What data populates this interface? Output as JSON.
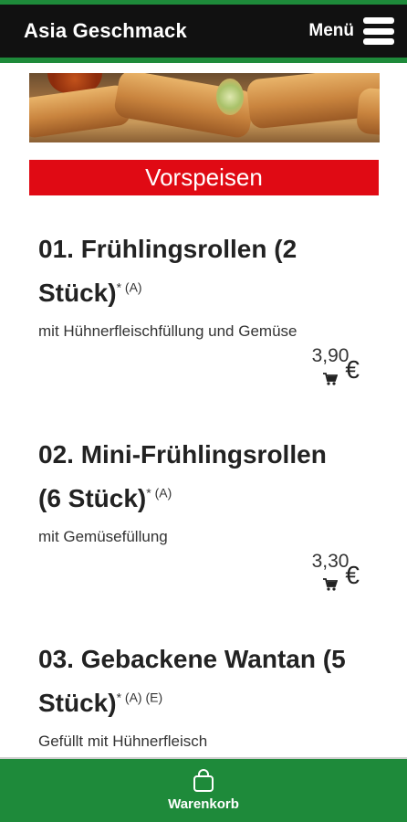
{
  "header": {
    "title": "Asia Geschmack",
    "menu_label": "Menü"
  },
  "section": {
    "title": "Vorspeisen"
  },
  "items": [
    {
      "title_line1": "01. Frühlingsrollen (2",
      "title_line2": "Stück)",
      "asterisk": "*",
      "allergens": "(A)",
      "description": "mit Hühnerfleischfüllung und Gemüse",
      "price": "3,90",
      "currency": "€"
    },
    {
      "title_line1": "02. Mini-Frühlingsrollen",
      "title_line2": "(6 Stück)",
      "asterisk": "*",
      "allergens": "(A)",
      "description": "mit Gemüsefüllung",
      "price": "3,30",
      "currency": "€"
    },
    {
      "title_line1": "03. Gebackene Wantan (5",
      "title_line2": "Stück)",
      "asterisk": "*",
      "allergens": "(A) (E)",
      "description": "Gefüllt mit Hühnerfleisch"
    }
  ],
  "footer": {
    "cart_label": "Warenkorb"
  },
  "colors": {
    "brand_green": "#1e8a3a",
    "section_red": "#e00a14",
    "header_black": "#111111"
  },
  "icons": {
    "menu": "hamburger-icon",
    "cart": "cart-icon",
    "basket": "shopping-bag-icon"
  }
}
